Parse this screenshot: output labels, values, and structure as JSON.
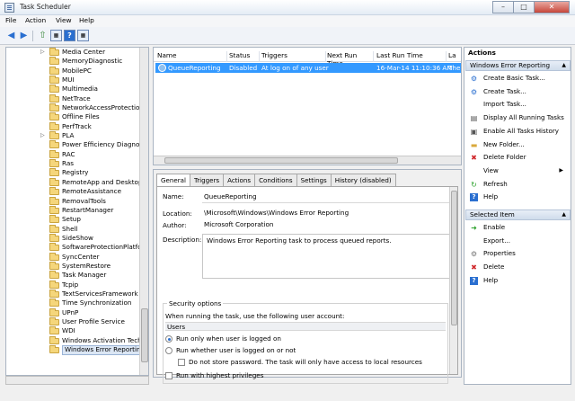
{
  "window": {
    "title": "Task Scheduler",
    "controls": [
      "–",
      "□",
      "✕"
    ]
  },
  "menu": [
    "File",
    "Action",
    "View",
    "Help"
  ],
  "tree": {
    "items": [
      {
        "label": "Media Center",
        "arrow": true
      },
      {
        "label": "MemoryDiagnostic",
        "arrow": false
      },
      {
        "label": "MobilePC",
        "arrow": false
      },
      {
        "label": "MUI",
        "arrow": false
      },
      {
        "label": "Multimedia",
        "arrow": false
      },
      {
        "label": "NetTrace",
        "arrow": false
      },
      {
        "label": "NetworkAccessProtection",
        "arrow": false
      },
      {
        "label": "Offline Files",
        "arrow": false
      },
      {
        "label": "PerfTrack",
        "arrow": false
      },
      {
        "label": "PLA",
        "arrow": true
      },
      {
        "label": "Power Efficiency Diagnostic",
        "arrow": false
      },
      {
        "label": "RAC",
        "arrow": false
      },
      {
        "label": "Ras",
        "arrow": false
      },
      {
        "label": "Registry",
        "arrow": false
      },
      {
        "label": "RemoteApp and Desktop C",
        "arrow": false
      },
      {
        "label": "RemoteAssistance",
        "arrow": false
      },
      {
        "label": "RemovalTools",
        "arrow": false
      },
      {
        "label": "RestartManager",
        "arrow": false
      },
      {
        "label": "Setup",
        "arrow": false
      },
      {
        "label": "Shell",
        "arrow": false
      },
      {
        "label": "SideShow",
        "arrow": false
      },
      {
        "label": "SoftwareProtectionPlatform",
        "arrow": false
      },
      {
        "label": "SyncCenter",
        "arrow": false
      },
      {
        "label": "SystemRestore",
        "arrow": false
      },
      {
        "label": "Task Manager",
        "arrow": false
      },
      {
        "label": "Tcpip",
        "arrow": false
      },
      {
        "label": "TextServicesFramework",
        "arrow": false
      },
      {
        "label": "Time Synchronization",
        "arrow": false
      },
      {
        "label": "UPnP",
        "arrow": false
      },
      {
        "label": "User Profile Service",
        "arrow": false
      },
      {
        "label": "WDI",
        "arrow": false
      },
      {
        "label": "Windows Activation Technologies",
        "arrow": false
      },
      {
        "label": "Windows Error Reporting",
        "arrow": false,
        "selected": true
      }
    ]
  },
  "list": {
    "columns": [
      "Name",
      "Status",
      "Triggers",
      "Next Run Time",
      "Last Run Time",
      "La"
    ],
    "rows": [
      {
        "name": "QueueReporting",
        "status": "Disabled",
        "triggers": "At log on of any user",
        "next_run": "",
        "last_run": "16-Mar-14 11:10:36 AM",
        "last_result": "The"
      }
    ]
  },
  "detail": {
    "tabs": [
      "General",
      "Triggers",
      "Actions",
      "Conditions",
      "Settings",
      "History (disabled)"
    ],
    "active_tab": "General",
    "name_label": "Name:",
    "name_value": "QueueReporting",
    "location_label": "Location:",
    "location_value": "\\Microsoft\\Windows\\Windows Error Reporting",
    "author_label": "Author:",
    "author_value": "Microsoft Corporation",
    "description_label": "Description:",
    "description_value": "Windows Error Reporting task to process queued reports.",
    "security": {
      "title": "Security options",
      "account_line": "When running the task, use the following user account:",
      "users": "Users",
      "opt_logged_on": "Run only when user is logged on",
      "opt_whether": "Run whether user is logged on or not",
      "opt_no_store": "Do not store password. The task will only have access to local resources",
      "opt_highest": "Run with highest privileges"
    }
  },
  "actions": {
    "header": "Actions",
    "section1": "Windows Error Reporting",
    "section1_items": [
      {
        "label": "Create Basic Task...",
        "icon": "create-basic-task-icon"
      },
      {
        "label": "Create Task...",
        "icon": "create-task-icon"
      },
      {
        "label": "Import Task...",
        "icon": ""
      },
      {
        "label": "Display All Running Tasks",
        "icon": "running-tasks-icon"
      },
      {
        "label": "Enable All Tasks History",
        "icon": "history-icon"
      },
      {
        "label": "New Folder...",
        "icon": "folder-icon"
      },
      {
        "label": "Delete Folder",
        "icon": "delete-icon"
      },
      {
        "label": "View",
        "icon": "",
        "submenu": true
      },
      {
        "label": "Refresh",
        "icon": "refresh-icon"
      },
      {
        "label": "Help",
        "icon": "help-icon"
      }
    ],
    "section2": "Selected Item",
    "section2_items": [
      {
        "label": "Enable",
        "icon": "enable-icon"
      },
      {
        "label": "Export...",
        "icon": ""
      },
      {
        "label": "Properties",
        "icon": "properties-icon"
      },
      {
        "label": "Delete",
        "icon": "delete-icon"
      },
      {
        "label": "Help",
        "icon": "help-icon"
      }
    ]
  },
  "colors": {
    "selection": "#3399ff",
    "accent": "#2a6fd0",
    "delete": "#d0282c",
    "enable": "#2aa02a"
  }
}
